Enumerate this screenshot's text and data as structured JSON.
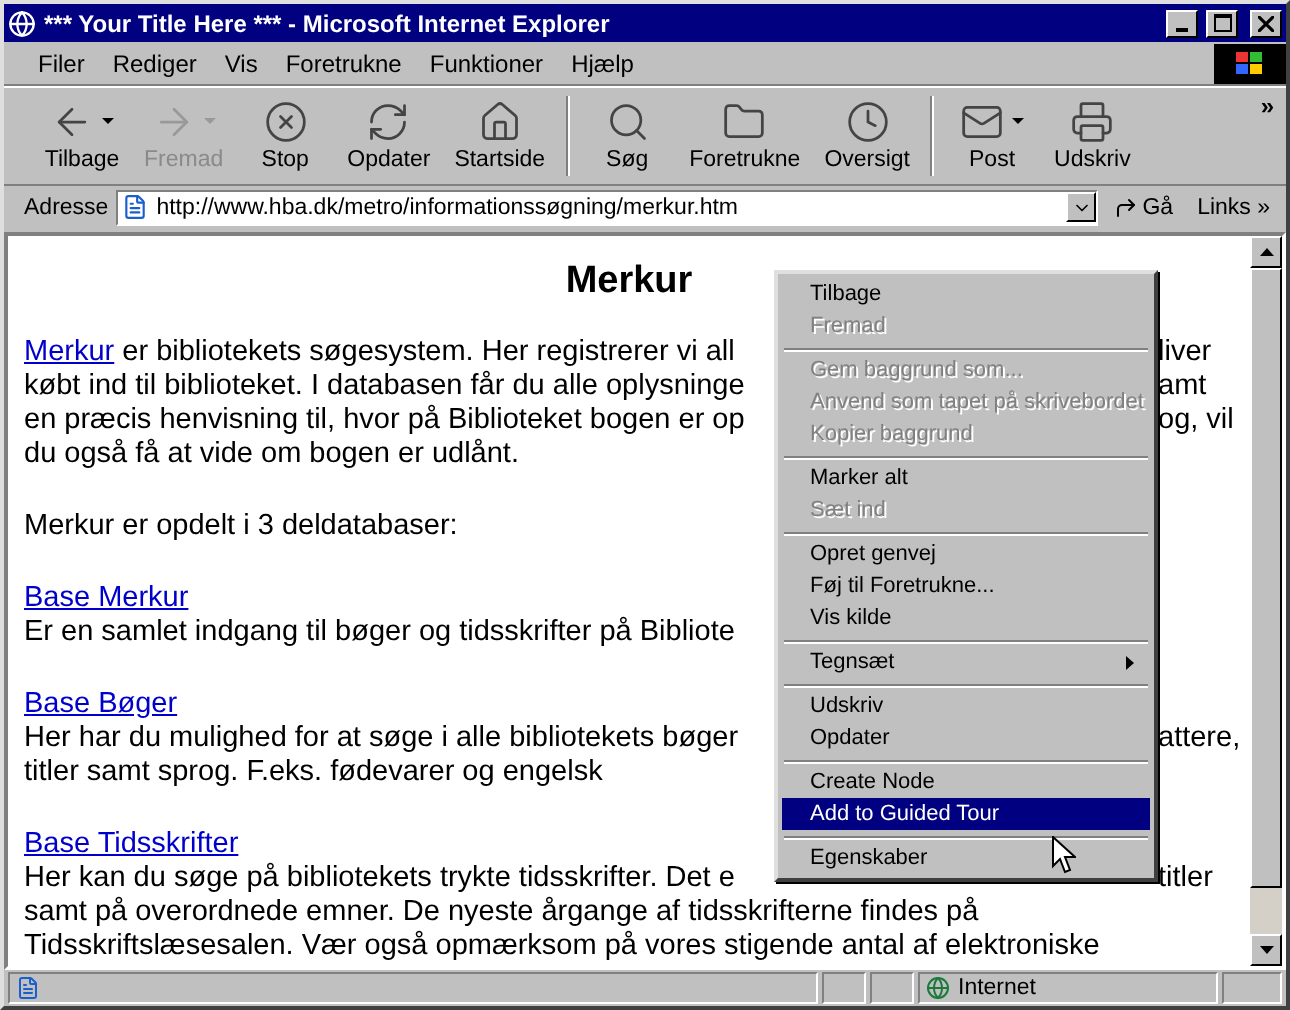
{
  "window": {
    "title": "*** Your Title Here *** - Microsoft Internet Explorer"
  },
  "menu_bar": [
    "Filer",
    "Rediger",
    "Vis",
    "Foretrukne",
    "Funktioner",
    "Hjælp"
  ],
  "toolbar": [
    {
      "kind": "back",
      "label": "Tilbage",
      "disabled": false,
      "dropdown": true
    },
    {
      "kind": "forward",
      "label": "Fremad",
      "disabled": true,
      "dropdown": true
    },
    {
      "kind": "stop",
      "label": "Stop",
      "disabled": false,
      "dropdown": false
    },
    {
      "kind": "refresh",
      "label": "Opdater",
      "disabled": false,
      "dropdown": false
    },
    {
      "kind": "home",
      "label": "Startside",
      "disabled": false,
      "dropdown": false
    },
    {
      "kind": "search",
      "label": "Søg",
      "disabled": false,
      "dropdown": false
    },
    {
      "kind": "favorites",
      "label": "Foretrukne",
      "disabled": false,
      "dropdown": false
    },
    {
      "kind": "history",
      "label": "Oversigt",
      "disabled": false,
      "dropdown": false
    },
    {
      "kind": "mail",
      "label": "Post",
      "disabled": false,
      "dropdown": true
    },
    {
      "kind": "print",
      "label": "Udskriv",
      "disabled": false,
      "dropdown": false
    }
  ],
  "toolbar_more": "»",
  "address_bar": {
    "label": "Adresse",
    "url": "http://www.hba.dk/metro/informationssøgning/merkur.htm",
    "go": "Gå",
    "links": "Links »"
  },
  "content": {
    "heading": "Merkur",
    "paragraphs": [
      {
        "lines": [
          {
            "segments": [
              {
                "kind": "link",
                "text": "Merkur"
              },
              {
                "kind": "text",
                "text": " er bibliotekets søgesystem. Her registrerer vi all"
              }
            ],
            "right": "liver"
          },
          {
            "segments": [
              {
                "kind": "text",
                "text": "købt ind til biblioteket. I databasen får du alle oplysninge"
              }
            ],
            "right": "amt"
          },
          {
            "segments": [
              {
                "kind": "text",
                "text": "en præcis henvisning til, hvor på Biblioteket bogen er op"
              }
            ],
            "right": "og, vil"
          },
          {
            "segments": [
              {
                "kind": "text",
                "text": "du også få at vide om bogen er udlånt."
              }
            ]
          }
        ]
      },
      {
        "lines": [
          {
            "segments": [
              {
                "kind": "text",
                "text": "Merkur er opdelt i 3 deldatabaser:"
              }
            ]
          }
        ]
      },
      {
        "lines": [
          {
            "segments": [
              {
                "kind": "link",
                "text": "Base Merkur"
              }
            ]
          },
          {
            "segments": [
              {
                "kind": "text",
                "text": "Er en samlet indgang til bøger og tidsskrifter på Bibliote"
              }
            ]
          }
        ]
      },
      {
        "lines": [
          {
            "segments": [
              {
                "kind": "link",
                "text": "Base Bøger"
              }
            ]
          },
          {
            "segments": [
              {
                "kind": "text",
                "text": "Her har du mulighed for at søge i alle bibliotekets bøger"
              }
            ],
            "right": "attere,"
          },
          {
            "segments": [
              {
                "kind": "text",
                "text": "titler samt sprog. F.eks. fødevarer og engelsk"
              }
            ]
          }
        ]
      },
      {
        "lines": [
          {
            "segments": [
              {
                "kind": "link",
                "text": "Base Tidsskrifter"
              }
            ]
          },
          {
            "segments": [
              {
                "kind": "text",
                "text": "Her kan du søge på bibliotekets trykte tidsskrifter. Det e"
              }
            ],
            "right": "titler"
          },
          {
            "segments": [
              {
                "kind": "text",
                "text": "samt på overordnede emner. De nyeste årgange af tidsskrifterne findes på"
              }
            ]
          },
          {
            "segments": [
              {
                "kind": "text",
                "text": "Tidsskriftslæsesalen. Vær også opmærksom på vores stigende antal af elektroniske"
              }
            ]
          }
        ]
      }
    ]
  },
  "context_menu": [
    {
      "kind": "item",
      "label": "Tilbage",
      "disabled": false,
      "selected": false
    },
    {
      "kind": "item",
      "label": "Fremad",
      "disabled": true,
      "selected": false
    },
    {
      "kind": "separator"
    },
    {
      "kind": "item",
      "label": "Gem baggrund som...",
      "disabled": true,
      "selected": false
    },
    {
      "kind": "item",
      "label": "Anvend som tapet på skrivebordet",
      "disabled": true,
      "selected": false
    },
    {
      "kind": "item",
      "label": "Kopier baggrund",
      "disabled": true,
      "selected": false
    },
    {
      "kind": "separator"
    },
    {
      "kind": "item",
      "label": "Marker alt",
      "disabled": false,
      "selected": false
    },
    {
      "kind": "item",
      "label": "Sæt ind",
      "disabled": true,
      "selected": false
    },
    {
      "kind": "separator"
    },
    {
      "kind": "item",
      "label": "Opret genvej",
      "disabled": false,
      "selected": false
    },
    {
      "kind": "item",
      "label": "Føj til Foretrukne...",
      "disabled": false,
      "selected": false
    },
    {
      "kind": "item",
      "label": "Vis kilde",
      "disabled": false,
      "selected": false
    },
    {
      "kind": "separator"
    },
    {
      "kind": "submenu",
      "label": "Tegnsæt",
      "disabled": false,
      "selected": false
    },
    {
      "kind": "separator"
    },
    {
      "kind": "item",
      "label": "Udskriv",
      "disabled": false,
      "selected": false
    },
    {
      "kind": "item",
      "label": "Opdater",
      "disabled": false,
      "selected": false
    },
    {
      "kind": "separator"
    },
    {
      "kind": "item",
      "label": "Create Node",
      "disabled": false,
      "selected": false
    },
    {
      "kind": "item",
      "label": "Add to Guided Tour",
      "disabled": false,
      "selected": true
    },
    {
      "kind": "separator"
    },
    {
      "kind": "item",
      "label": "Egenskaber",
      "disabled": false,
      "selected": false
    }
  ],
  "status_bar": {
    "zone": "Internet"
  }
}
